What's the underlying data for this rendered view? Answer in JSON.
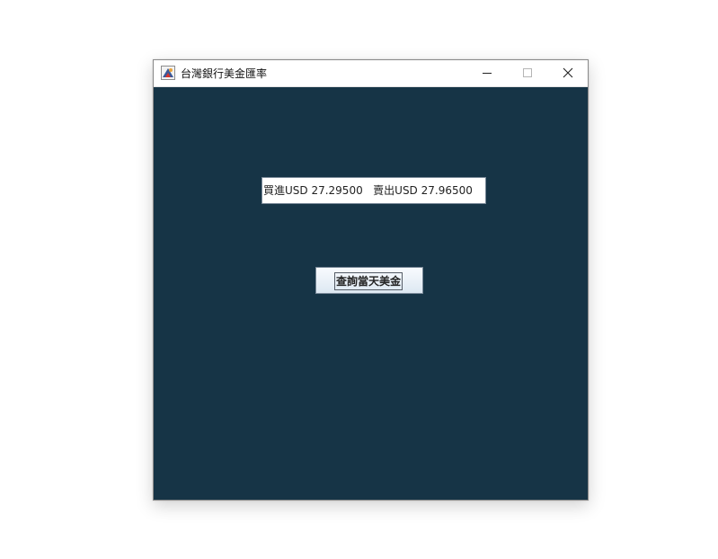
{
  "window": {
    "title": "台灣銀行美金匯率",
    "icons": {
      "app": "java-app-icon",
      "minimize": "minimize-icon",
      "maximize": "maximize-icon",
      "close": "close-icon"
    }
  },
  "rate_display": {
    "value": "買進USD 27.29500   賣出USD 27.96500"
  },
  "query_button": {
    "label": "查詢當天美金"
  },
  "colors": {
    "background": "#163446",
    "titlebar": "#ffffff",
    "button_face": "#dde8f2"
  }
}
